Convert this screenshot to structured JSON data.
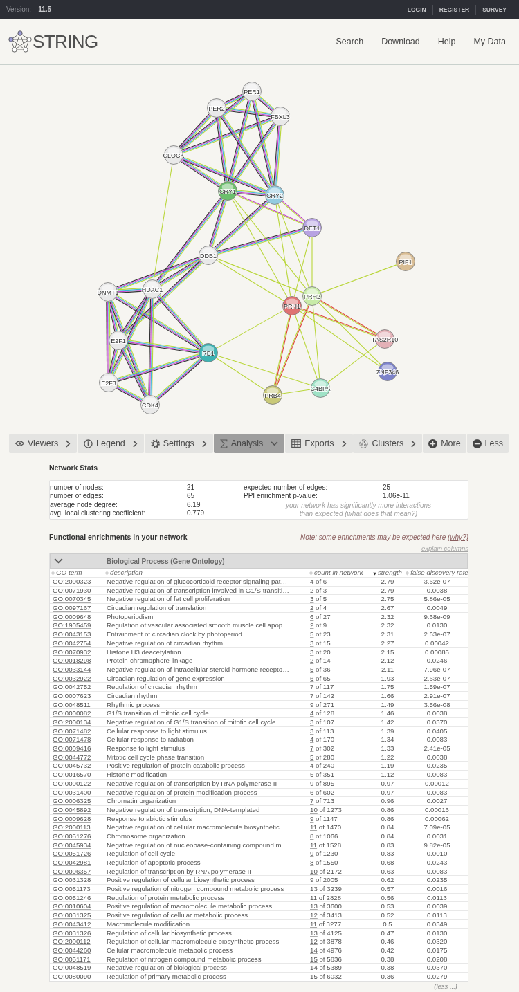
{
  "top_bar": {
    "version_label": "Version:",
    "version": "11.5",
    "links": [
      "LOGIN",
      "REGISTER",
      "SURVEY"
    ]
  },
  "header": {
    "logo_text": "STRING",
    "nav": [
      "Search",
      "Download",
      "Help",
      "My Data"
    ]
  },
  "network": {
    "nodes": [
      {
        "label": "PER1",
        "color": "#e9e9e9"
      },
      {
        "label": "PER2",
        "color": "#e9e9e9"
      },
      {
        "label": "FBXL3",
        "color": "#e9e9e9"
      },
      {
        "label": "CLOCK",
        "color": "#e9e9e9"
      },
      {
        "label": "CRY1",
        "color": "#6cbf6c"
      },
      {
        "label": "CRY2",
        "color": "#93cbe0"
      },
      {
        "label": "DET1",
        "color": "#b7a2e2"
      },
      {
        "label": "DDB1",
        "color": "#e9e9e9"
      },
      {
        "label": "PIF1",
        "color": "#d9bd94"
      },
      {
        "label": "DNMT1",
        "color": "#e9e9e9"
      },
      {
        "label": "HDAC1",
        "color": "#e9e9e9"
      },
      {
        "label": "PRH2",
        "color": "#c8eba8"
      },
      {
        "label": "PRH1",
        "color": "#df7272"
      },
      {
        "label": "E2F1",
        "color": "#e9e9e9"
      },
      {
        "label": "RB1",
        "color": "#3eb3b3"
      },
      {
        "label": "TAS2R10",
        "color": "#e3b0b6"
      },
      {
        "label": "ZNF346",
        "color": "#7d83cb"
      },
      {
        "label": "E2F3",
        "color": "#e9e9e9"
      },
      {
        "label": "C4BPA",
        "color": "#9fe2c6"
      },
      {
        "label": "PRB4",
        "color": "#c9c978"
      },
      {
        "label": "CDK4",
        "color": "#e9e9e9"
      }
    ]
  },
  "toolbar": {
    "tabs": [
      {
        "label": "Viewers",
        "selected": false
      },
      {
        "label": "Legend",
        "selected": false
      },
      {
        "label": "Settings",
        "selected": false
      },
      {
        "label": "Analysis",
        "selected": true
      },
      {
        "label": "Exports",
        "selected": false
      },
      {
        "label": "Clusters",
        "selected": false
      }
    ],
    "buttons": [
      "More",
      "Less"
    ]
  },
  "network_stats": {
    "title": "Network Stats",
    "left": [
      {
        "label": "number of nodes:",
        "value": "21"
      },
      {
        "label": "number of edges:",
        "value": "65"
      },
      {
        "label": "average node degree:",
        "value": "6.19"
      },
      {
        "label": "avg. local clustering coefficient:",
        "value": "0.779"
      }
    ],
    "right": [
      {
        "label": "expected number of edges:",
        "value": "25"
      },
      {
        "label": "PPI enrichment p-value:",
        "value": "1.06e-11"
      }
    ],
    "note": "your network has significantly more interactions than expected",
    "note_link": "(what does that mean?)"
  },
  "enrichments": {
    "title": "Functional enrichments in your network",
    "note": "Note: some enrichments may be expected here",
    "note_link": "(why?)",
    "explain": "explain columns",
    "section": {
      "title": "Biological Process (Gene Ontology)",
      "expanded": true
    },
    "columns": [
      {
        "label": "GO-term",
        "sorted": false
      },
      {
        "label": "description",
        "sorted": false
      },
      {
        "label": "count in network",
        "sorted": false
      },
      {
        "label": "strength",
        "sorted": true
      },
      {
        "label": "false discovery rate",
        "sorted": false
      }
    ],
    "rows": [
      {
        "term": "GO:2000323",
        "description": "Negative regulation of glucocorticoid receptor signaling pat…",
        "count_hits": "4",
        "count_rest": "of 6",
        "strength": "2.79",
        "fdr": "3.62e-07"
      },
      {
        "term": "GO:0071930",
        "description": "Negative regulation of transcription involved in G1/S transiti…",
        "count_hits": "2",
        "count_rest": "of 3",
        "strength": "2.79",
        "fdr": "0.0038"
      },
      {
        "term": "GO:0070345",
        "description": "Negative regulation of fat cell proliferation",
        "count_hits": "3",
        "count_rest": "of 5",
        "strength": "2.75",
        "fdr": "5.86e-05"
      },
      {
        "term": "GO:0097167",
        "description": "Circadian regulation of translation",
        "count_hits": "2",
        "count_rest": "of 4",
        "strength": "2.67",
        "fdr": "0.0049"
      },
      {
        "term": "GO:0009648",
        "description": "Photoperiodism",
        "count_hits": "6",
        "count_rest": "of 27",
        "strength": "2.32",
        "fdr": "9.68e-09"
      },
      {
        "term": "GO:1905459",
        "description": "Regulation of vascular associated smooth muscle cell apop…",
        "count_hits": "2",
        "count_rest": "of 9",
        "strength": "2.32",
        "fdr": "0.0130"
      },
      {
        "term": "GO:0043153",
        "description": "Entrainment of circadian clock by photoperiod",
        "count_hits": "5",
        "count_rest": "of 23",
        "strength": "2.31",
        "fdr": "2.63e-07"
      },
      {
        "term": "GO:0042754",
        "description": "Negative regulation of circadian rhythm",
        "count_hits": "3",
        "count_rest": "of 15",
        "strength": "2.27",
        "fdr": "0.00042"
      },
      {
        "term": "GO:0070932",
        "description": "Histone H3 deacetylation",
        "count_hits": "3",
        "count_rest": "of 20",
        "strength": "2.15",
        "fdr": "0.00085"
      },
      {
        "term": "GO:0018298",
        "description": "Protein-chromophore linkage",
        "count_hits": "2",
        "count_rest": "of 14",
        "strength": "2.12",
        "fdr": "0.0246"
      },
      {
        "term": "GO:0033144",
        "description": "Negative regulation of intracellular steroid hormone recepto…",
        "count_hits": "5",
        "count_rest": "of 36",
        "strength": "2.11",
        "fdr": "7.96e-07"
      },
      {
        "term": "GO:0032922",
        "description": "Circadian regulation of gene expression",
        "count_hits": "6",
        "count_rest": "of 65",
        "strength": "1.93",
        "fdr": "2.63e-07"
      },
      {
        "term": "GO:0042752",
        "description": "Regulation of circadian rhythm",
        "count_hits": "7",
        "count_rest": "of 117",
        "strength": "1.75",
        "fdr": "1.59e-07"
      },
      {
        "term": "GO:0007623",
        "description": "Circadian rhythm",
        "count_hits": "7",
        "count_rest": "of 142",
        "strength": "1.66",
        "fdr": "2.91e-07"
      },
      {
        "term": "GO:0048511",
        "description": "Rhythmic process",
        "count_hits": "9",
        "count_rest": "of 271",
        "strength": "1.49",
        "fdr": "3.56e-08"
      },
      {
        "term": "GO:0000082",
        "description": "G1/S transition of mitotic cell cycle",
        "count_hits": "4",
        "count_rest": "of 128",
        "strength": "1.46",
        "fdr": "0.0038"
      },
      {
        "term": "GO:2000134",
        "description": "Negative regulation of G1/S transition of mitotic cell cycle",
        "count_hits": "3",
        "count_rest": "of 107",
        "strength": "1.42",
        "fdr": "0.0370"
      },
      {
        "term": "GO:0071482",
        "description": "Cellular response to light stimulus",
        "count_hits": "3",
        "count_rest": "of 113",
        "strength": "1.39",
        "fdr": "0.0405"
      },
      {
        "term": "GO:0071478",
        "description": "Cellular response to radiation",
        "count_hits": "4",
        "count_rest": "of 170",
        "strength": "1.34",
        "fdr": "0.0083"
      },
      {
        "term": "GO:0009416",
        "description": "Response to light stimulus",
        "count_hits": "7",
        "count_rest": "of 302",
        "strength": "1.33",
        "fdr": "2.41e-05"
      },
      {
        "term": "GO:0044772",
        "description": "Mitotic cell cycle phase transition",
        "count_hits": "5",
        "count_rest": "of 280",
        "strength": "1.22",
        "fdr": "0.0038"
      },
      {
        "term": "GO:0045732",
        "description": "Positive regulation of protein catabolic process",
        "count_hits": "4",
        "count_rest": "of 240",
        "strength": "1.19",
        "fdr": "0.0235"
      },
      {
        "term": "GO:0016570",
        "description": "Histone modification",
        "count_hits": "5",
        "count_rest": "of 351",
        "strength": "1.12",
        "fdr": "0.0083"
      },
      {
        "term": "GO:0000122",
        "description": "Negative regulation of transcription by RNA polymerase II",
        "count_hits": "9",
        "count_rest": "of 895",
        "strength": "0.97",
        "fdr": "0.00012"
      },
      {
        "term": "GO:0031400",
        "description": "Negative regulation of protein modification process",
        "count_hits": "6",
        "count_rest": "of 602",
        "strength": "0.97",
        "fdr": "0.0083"
      },
      {
        "term": "GO:0006325",
        "description": "Chromatin organization",
        "count_hits": "7",
        "count_rest": "of 713",
        "strength": "0.96",
        "fdr": "0.0027"
      },
      {
        "term": "GO:0045892",
        "description": "Negative regulation of transcription, DNA-templated",
        "count_hits": "10",
        "count_rest": "of 1273",
        "strength": "0.86",
        "fdr": "0.00016"
      },
      {
        "term": "GO:0009628",
        "description": "Response to abiotic stimulus",
        "count_hits": "9",
        "count_rest": "of 1147",
        "strength": "0.86",
        "fdr": "0.00062"
      },
      {
        "term": "GO:2000113",
        "description": "Negative regulation of cellular macromolecule biosynthetic …",
        "count_hits": "11",
        "count_rest": "of 1470",
        "strength": "0.84",
        "fdr": "7.09e-05"
      },
      {
        "term": "GO:0051276",
        "description": "Chromosome organization",
        "count_hits": "8",
        "count_rest": "of 1066",
        "strength": "0.84",
        "fdr": "0.0031"
      },
      {
        "term": "GO:0045934",
        "description": "Negative regulation of nucleobase-containing compound m…",
        "count_hits": "11",
        "count_rest": "of 1528",
        "strength": "0.83",
        "fdr": "9.82e-05"
      },
      {
        "term": "GO:0051726",
        "description": "Regulation of cell cycle",
        "count_hits": "9",
        "count_rest": "of 1230",
        "strength": "0.83",
        "fdr": "0.0010"
      },
      {
        "term": "GO:0042981",
        "description": "Regulation of apoptotic process",
        "count_hits": "8",
        "count_rest": "of 1550",
        "strength": "0.68",
        "fdr": "0.0243"
      },
      {
        "term": "GO:0006357",
        "description": "Regulation of transcription by RNA polymerase II",
        "count_hits": "10",
        "count_rest": "of 2172",
        "strength": "0.63",
        "fdr": "0.0083"
      },
      {
        "term": "GO:0031328",
        "description": "Positive regulation of cellular biosynthetic process",
        "count_hits": "9",
        "count_rest": "of 2005",
        "strength": "0.62",
        "fdr": "0.0235"
      },
      {
        "term": "GO:0051173",
        "description": "Positive regulation of nitrogen compound metabolic process",
        "count_hits": "13",
        "count_rest": "of 3239",
        "strength": "0.57",
        "fdr": "0.0016"
      },
      {
        "term": "GO:0051246",
        "description": "Regulation of protein metabolic process",
        "count_hits": "11",
        "count_rest": "of 2828",
        "strength": "0.56",
        "fdr": "0.0113"
      },
      {
        "term": "GO:0010604",
        "description": "Positive regulation of macromolecule metabolic process",
        "count_hits": "13",
        "count_rest": "of 3600",
        "strength": "0.53",
        "fdr": "0.0039"
      },
      {
        "term": "GO:0031325",
        "description": "Positive regulation of cellular metabolic process",
        "count_hits": "12",
        "count_rest": "of 3413",
        "strength": "0.52",
        "fdr": "0.0113"
      },
      {
        "term": "GO:0043412",
        "description": "Macromolecule modification",
        "count_hits": "11",
        "count_rest": "of 3277",
        "strength": "0.5",
        "fdr": "0.0349"
      },
      {
        "term": "GO:0031326",
        "description": "Regulation of cellular biosynthetic process",
        "count_hits": "13",
        "count_rest": "of 4125",
        "strength": "0.47",
        "fdr": "0.0130"
      },
      {
        "term": "GO:2000112",
        "description": "Regulation of cellular macromolecule biosynthetic process",
        "count_hits": "12",
        "count_rest": "of 3878",
        "strength": "0.46",
        "fdr": "0.0320"
      },
      {
        "term": "GO:0044260",
        "description": "Cellular macromolecule metabolic process",
        "count_hits": "14",
        "count_rest": "of 4976",
        "strength": "0.42",
        "fdr": "0.0175"
      },
      {
        "term": "GO:0051171",
        "description": "Regulation of nitrogen compound metabolic process",
        "count_hits": "15",
        "count_rest": "of 5836",
        "strength": "0.38",
        "fdr": "0.0208"
      },
      {
        "term": "GO:0048519",
        "description": "Negative regulation of biological process",
        "count_hits": "14",
        "count_rest": "of 5389",
        "strength": "0.38",
        "fdr": "0.0370"
      },
      {
        "term": "GO:0080090",
        "description": "Regulation of primary metabolic process",
        "count_hits": "15",
        "count_rest": "of 6032",
        "strength": "0.36",
        "fdr": "0.0279"
      }
    ],
    "less": "(less ...)"
  }
}
